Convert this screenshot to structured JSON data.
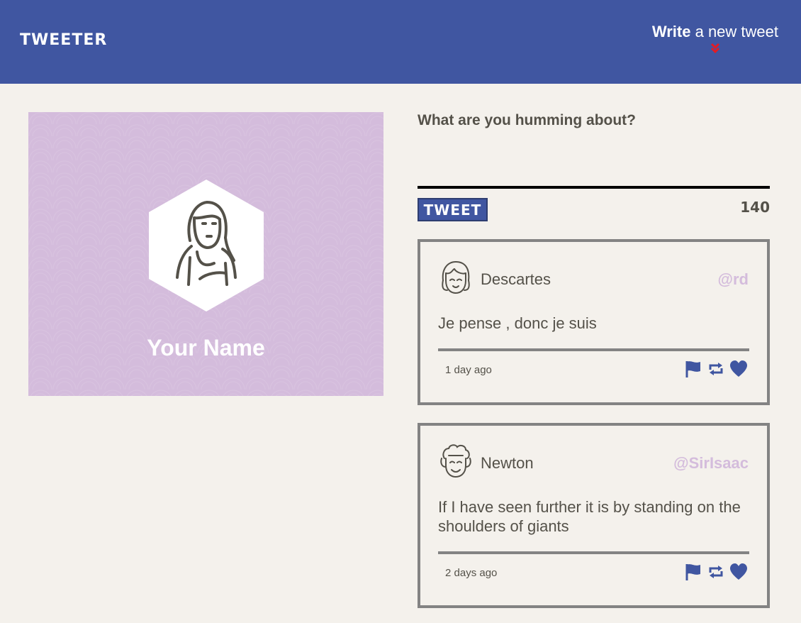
{
  "nav": {
    "brand": "TWEETER",
    "compose_bold": "Write",
    "compose_rest": " a new tweet"
  },
  "profile": {
    "name": "Your Name",
    "background_color": "#d4bcdc"
  },
  "compose": {
    "label": "What are you humming about?",
    "textarea_value": "",
    "button_label": "TWEET",
    "counter": "140"
  },
  "tweets": [
    {
      "author": "Descartes",
      "handle": "@rd",
      "text": "Je pense , donc je suis",
      "age": "1 day ago",
      "actions": [
        "flag-icon",
        "retweet-icon",
        "heart-icon"
      ]
    },
    {
      "author": "Newton",
      "handle": "@SirIsaac",
      "text": "If I have seen further it is by standing on the shoulders of giants",
      "age": "2 days ago",
      "actions": [
        "flag-icon",
        "retweet-icon",
        "heart-icon"
      ]
    }
  ],
  "colors": {
    "nav": "#4056a1",
    "page": "#f4f1ec",
    "accent": "#d4bcdc",
    "chevron": "#e31b23",
    "icon": "#4056a1"
  }
}
